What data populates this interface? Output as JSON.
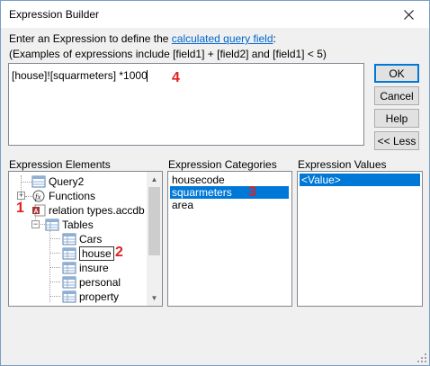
{
  "window": {
    "title": "Expression Builder"
  },
  "instructions": {
    "line1_prefix": "Enter an Expression to define the ",
    "line1_link": "calculated query field",
    "line1_suffix": ":",
    "line2": "(Examples of expressions include [field1] + [field2] and [field1] < 5)"
  },
  "expression": {
    "value": "[house]![squarmeters] *100",
    "last_char": "0"
  },
  "buttons": {
    "ok": "OK",
    "cancel": "Cancel",
    "help": "Help",
    "less": "<< Less"
  },
  "sections": {
    "elements_label": "Expression Elements",
    "categories_label": "Expression Categories",
    "values_label": "Expression Values"
  },
  "elements_tree": [
    {
      "label": "Query2"
    },
    {
      "label": "Functions"
    },
    {
      "label": "relation types.accdb"
    },
    {
      "label": "Tables"
    },
    {
      "label": "Cars"
    },
    {
      "label": "house"
    },
    {
      "label": "insure"
    },
    {
      "label": "personal"
    },
    {
      "label": "property"
    }
  ],
  "categories": [
    {
      "label": "housecode"
    },
    {
      "label": "squarmeters"
    },
    {
      "label": "area"
    }
  ],
  "values": [
    {
      "label": "<Value>"
    }
  ],
  "annotations": {
    "a1": "1",
    "a2": "2",
    "a3": "3",
    "a4": "4"
  },
  "colors": {
    "selection": "#0078d7",
    "annotation": "#e02020",
    "link": "#0066cc"
  }
}
